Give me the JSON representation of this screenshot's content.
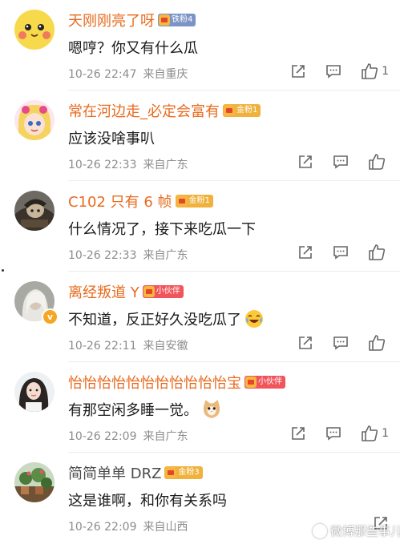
{
  "comments": [
    {
      "name": "天刚刚亮了呀",
      "badge": "铁粉4",
      "badge_color": "#7a94c6",
      "text": "嗯哼？你又有什么瓜",
      "time": "10-26 22:47",
      "location": "来自重庆",
      "likes": "1",
      "avatar": "yellow-pokemon",
      "verified": false
    },
    {
      "name": "常在河边走_必定会富有",
      "badge": "金粉1",
      "badge_color": "#f0b23d",
      "text": "应该没啥事叭",
      "time": "10-26 22:33",
      "location": "来自广东",
      "likes": "",
      "avatar": "anime-girl",
      "verified": false
    },
    {
      "name": "C102 只有 6 帧",
      "badge": "金粉1",
      "badge_color": "#f0b23d",
      "text": "什么情况了，接下来吃瓜一下",
      "time": "10-26 22:33",
      "location": "来自广东",
      "likes": "",
      "avatar": "dark-character",
      "verified": false
    },
    {
      "name": "离经叛道 Y",
      "badge": "小伙伴",
      "badge_color": "#f0555c",
      "text": "不知道，反正好久没吃瓜了",
      "emoji": "laughing-tears-emoji",
      "time": "10-26 22:11",
      "location": "来自安徽",
      "likes": "",
      "avatar": "white-hair-figure",
      "verified": true
    },
    {
      "name": "怡怡怡怡怡怡怡怡怡怡怡宝",
      "badge": "小伙伴",
      "badge_color": "#f0555c",
      "text": "有那空闲多睡一觉。",
      "emoji": "cat-emoji",
      "time": "10-26 22:09",
      "location": "来自广东",
      "likes": "1",
      "avatar": "girl-photo",
      "verified": false
    },
    {
      "name": "简简单单 DRZ",
      "badge": "金粉3",
      "badge_color": "#f0b23d",
      "text": "这是谁啊，和你有关系吗",
      "time": "10-26 22:09",
      "location": "来自山西",
      "likes": "",
      "avatar": "plant-photo",
      "verified": false
    }
  ],
  "watermark": {
    "text": "微博那些事儿"
  },
  "colors": {
    "name_orange": "#e86a1e",
    "meta_gray": "#8c8c8c",
    "icon_gray": "#666666"
  }
}
